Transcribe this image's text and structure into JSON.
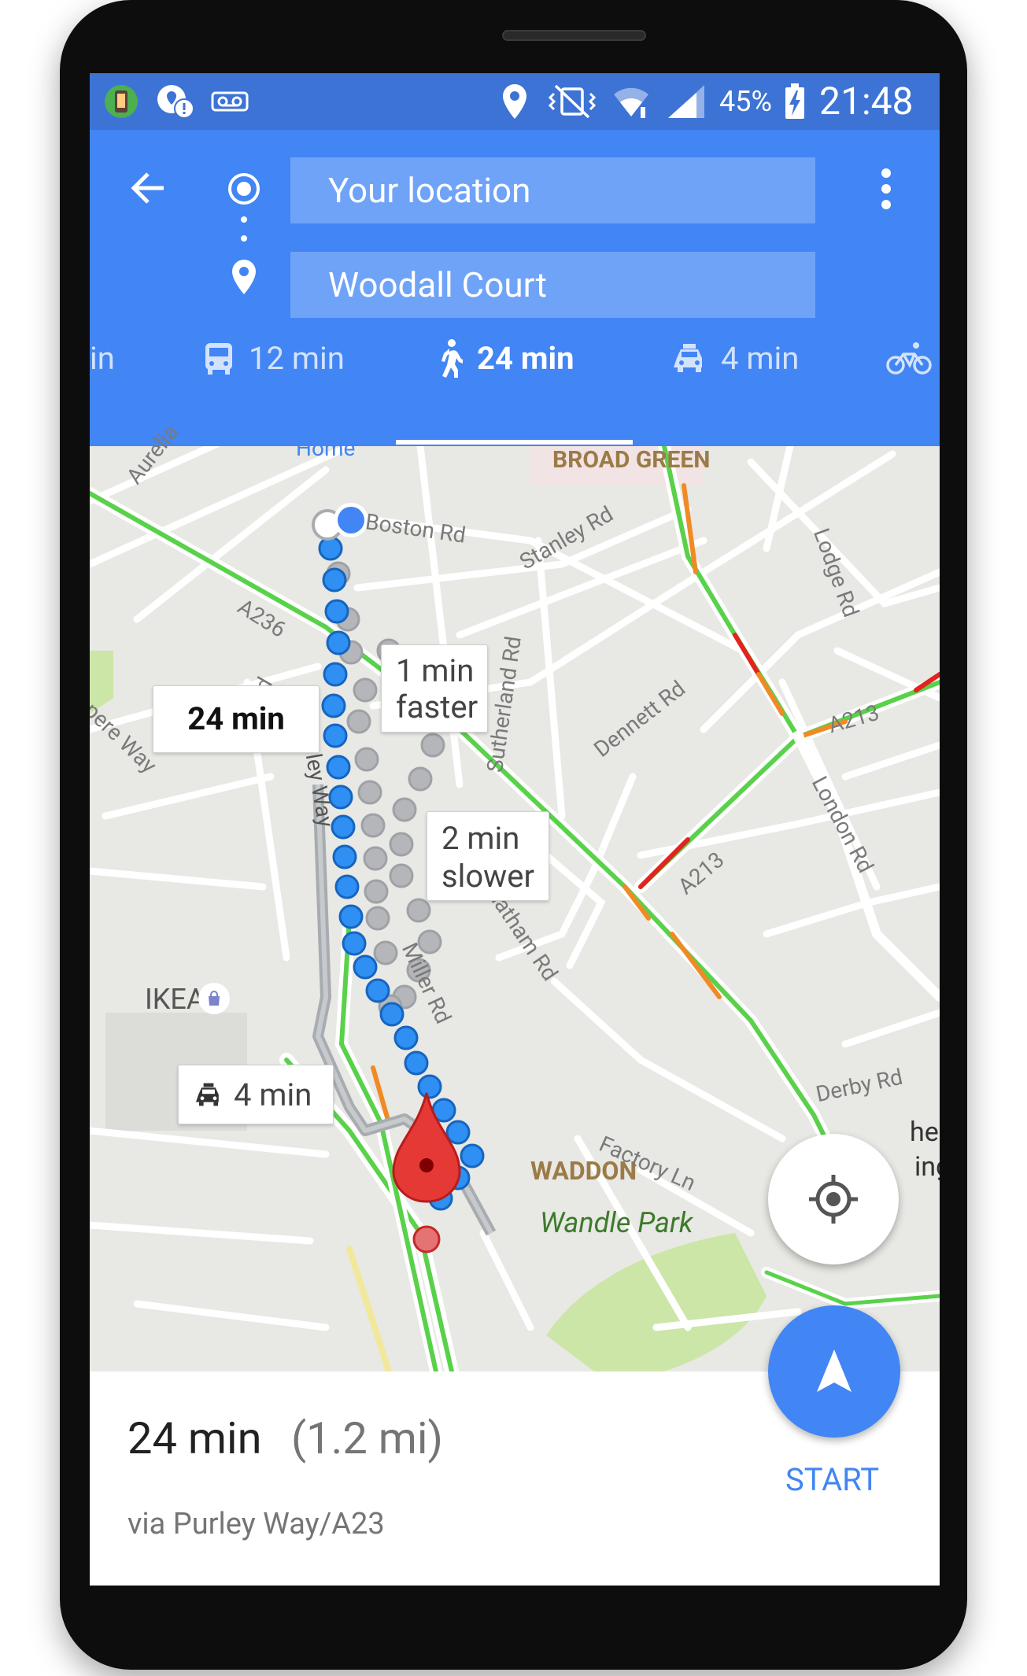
{
  "status_bar": {
    "battery": "45%",
    "time": "21:48"
  },
  "directions": {
    "origin": "Your location",
    "destination": "Woodall Court"
  },
  "modes": [
    {
      "label": "in"
    },
    {
      "label": "12 min"
    },
    {
      "label": "24 min"
    },
    {
      "label": "4 min"
    }
  ],
  "map": {
    "place_labels": {
      "broad_green": "BROAD GREEN",
      "waddon": "WADDON",
      "wandle_park": "Wandle Park",
      "ikea": "IKEA",
      "home": "Home",
      "the_w": "he W",
      "ing": "ing"
    },
    "roads": {
      "aurelia": "Aurelia",
      "boston": "Boston Rd",
      "stanley": "Stanley Rd",
      "lodge": "Lodge Rd",
      "a236": "A236",
      "rd": "Rd",
      "ampere": "mpere Way",
      "purley": "Purley Way",
      "sutherland": "Sutherland Rd",
      "dennett": "Dennett Rd",
      "a213_1": "A213",
      "a213_2": "A213",
      "london": "London Rd",
      "miller": "Miller Rd",
      "chatham": "Chatham Rd",
      "derby": "Derby Rd",
      "factory": "Factory Ln"
    },
    "bubbles": {
      "main_time": "24 min",
      "alt1_line1": "1 min",
      "alt1_line2": "faster",
      "alt2_line1": "2 min",
      "alt2_line2": "slower",
      "taxi_time": "4 min"
    },
    "colors": {
      "route_blue": "#2f8ff2",
      "route_alt": "#a8acb0",
      "traffic_green": "#5ad14b",
      "traffic_orange": "#f08a24",
      "traffic_red": "#e3231f",
      "park": "#cbe6a7"
    }
  },
  "summary": {
    "duration": "24 min",
    "distance": "(1.2 mi)",
    "via": "via Purley Way/A23",
    "start_label": "START"
  },
  "icons": {
    "back": "arrow-left-icon",
    "more": "more-vert-icon",
    "origin": "origin-dot-icon",
    "destination": "place-pin-icon",
    "transit": "bus-icon",
    "walk": "walk-icon",
    "taxi": "taxi-icon",
    "bike": "bike-icon",
    "locate": "my-location-icon",
    "navigate": "navigation-arrow-icon"
  }
}
